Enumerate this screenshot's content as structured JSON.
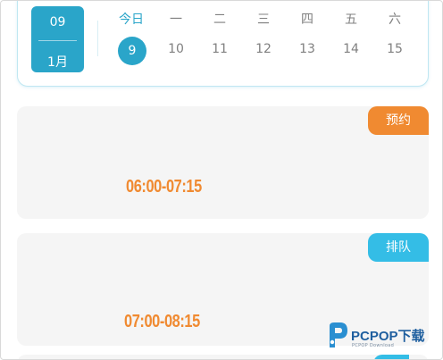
{
  "calendar": {
    "today_box": {
      "day": "09",
      "month": "1月"
    },
    "weekdays": [
      "今日",
      "一",
      "二",
      "三",
      "四",
      "五",
      "六"
    ],
    "dates": [
      "9",
      "10",
      "11",
      "12",
      "13",
      "14",
      "15"
    ],
    "selected_date": "9"
  },
  "appointments": [
    {
      "status": "预约",
      "time": "06:00-07:15"
    },
    {
      "status": "排队",
      "time": "07:00-08:15"
    }
  ],
  "watermark": {
    "brand": "PCPOP下载",
    "sub": "PCPOP Download"
  },
  "colors": {
    "accent": "#2aa5c9",
    "orange": "#f08a31",
    "blue_tag": "#34bde6",
    "card_bg": "#f5f5f5"
  }
}
